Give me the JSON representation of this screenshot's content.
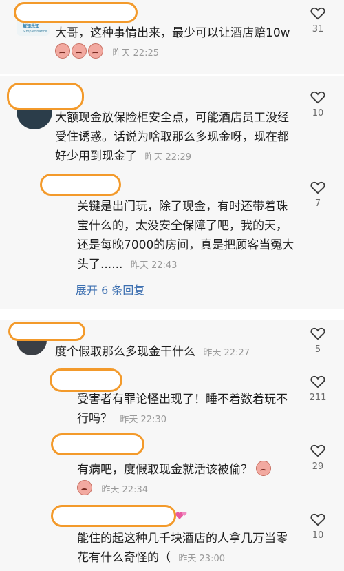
{
  "comments": [
    {
      "text": "大哥，这种事情出来，最少可以让酒店赔10w",
      "time": "昨天 22:25",
      "likes": "31"
    },
    {
      "text": "大额现金放保险柜安全点，可能酒店员工没经受住诱惑。话说为啥取那么多现金呀，现在都好少用到现金了",
      "time": "昨天 22:29",
      "likes": "10"
    },
    {
      "text": "关键是出门玩，除了现金，有时还带着珠宝什么的，太没安全保障了吧，我的天，还是每晚7000的房间，真是把顾客当冤大头了......",
      "time": "昨天 22:43",
      "likes": "7"
    },
    {
      "text": "度个假取那么多现金干什么",
      "time": "昨天 22:27",
      "likes": "5"
    },
    {
      "text": "受害者有罪论怪出现了！睡不着数着玩不行吗？",
      "time": "昨天 22:30",
      "likes": "211"
    },
    {
      "text": "有病吧，度假取现金就活该被偷？",
      "time": "昨天 22:34",
      "likes": "29"
    },
    {
      "text": "能住的起这种几千块酒店的人拿几万当零花有什么奇怪的（",
      "time": "昨天 23:00",
      "likes": "10"
    }
  ],
  "expand_replies": "展开 6 条回复",
  "avatar_label": "解知乐知",
  "avatar_sublabel": "Simplefinance"
}
